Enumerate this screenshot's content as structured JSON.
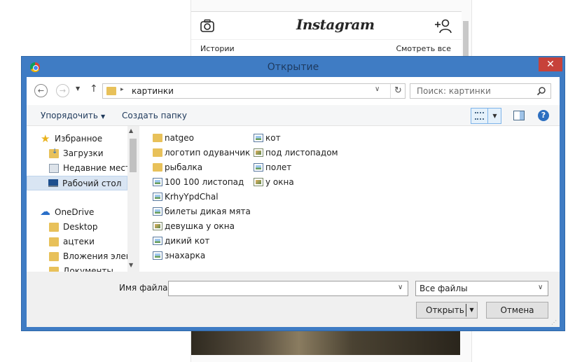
{
  "instagram": {
    "logo": "Instagram",
    "stories_label": "Истории",
    "watch_all": "Смотреть все",
    "icons": [
      "camera-icon",
      "add-user-icon"
    ]
  },
  "dialog": {
    "title": "Открытие",
    "close_label": "✕",
    "address": {
      "current_folder": "картинки",
      "separator": "▸"
    },
    "search": {
      "placeholder": "Поиск: картинки"
    },
    "toolbar": {
      "organize": "Упорядочить",
      "new_folder": "Создать папку"
    },
    "nav": {
      "favorites": "Избранное",
      "downloads": "Загрузки",
      "recent": "Недавние места",
      "desktop": "Рабочий стол",
      "onedrive": "OneDrive",
      "od_desktop": "Desktop",
      "od_aztecs": "ацтеки",
      "od_attachments": "Вложения электронной почты",
      "od_documents": "Документы"
    },
    "files_col1": [
      {
        "name": "natgeo",
        "kind": "folder"
      },
      {
        "name": "логотип одуванчик",
        "kind": "folder"
      },
      {
        "name": "рыбалка",
        "kind": "folder"
      },
      {
        "name": "100 100 листопад",
        "kind": "image"
      },
      {
        "name": "KrhyYpdChal",
        "kind": "image"
      },
      {
        "name": "билеты дикая мята",
        "kind": "image"
      },
      {
        "name": "девушка у окна",
        "kind": "photo"
      },
      {
        "name": "дикий кот",
        "kind": "image"
      },
      {
        "name": "знахарка",
        "kind": "image"
      }
    ],
    "files_col2": [
      {
        "name": "кот",
        "kind": "image"
      },
      {
        "name": "под листопадом",
        "kind": "photo"
      },
      {
        "name": "полет",
        "kind": "image"
      },
      {
        "name": "у окна",
        "kind": "photo"
      }
    ],
    "filename_label": "Имя файла:",
    "filename_value": "",
    "filetype": "Все файлы",
    "open_label": "Открыть",
    "cancel_label": "Отмена",
    "colors": {
      "frame": "#3f7cc4",
      "close": "#c7423a",
      "selected": "#d9e5f3"
    }
  }
}
